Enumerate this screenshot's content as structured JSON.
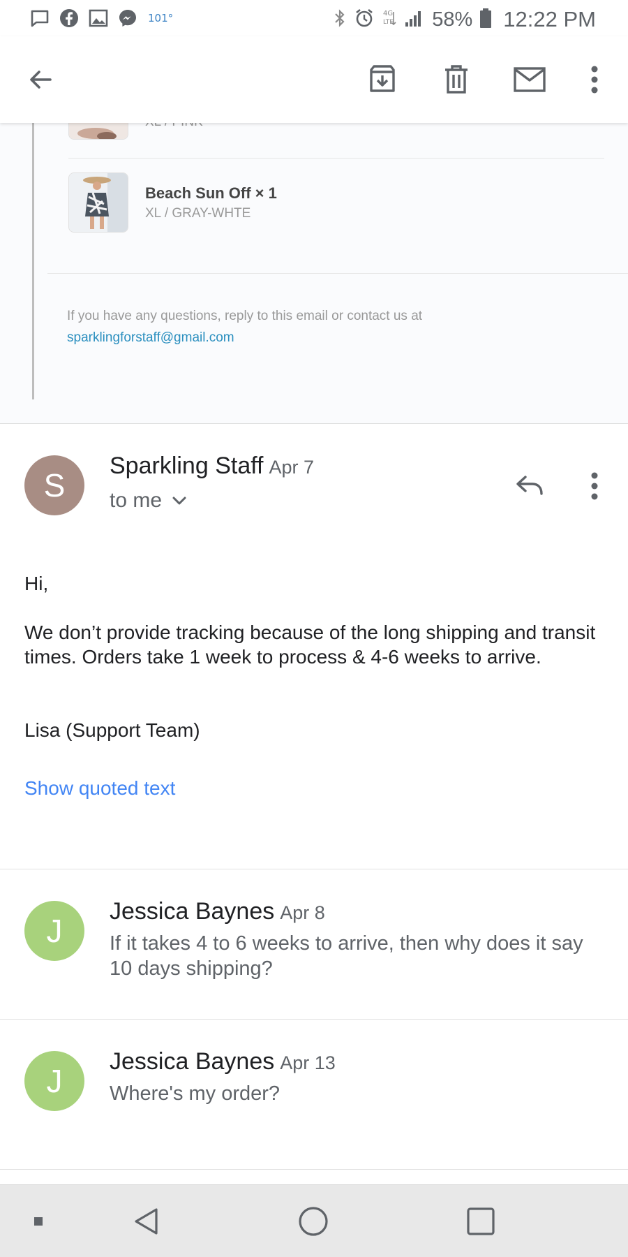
{
  "status_bar": {
    "temperature": "101°",
    "battery_percent": "58%",
    "time": "12:22 PM",
    "left_icons": [
      "message-icon",
      "facebook-icon",
      "gallery-icon",
      "messenger-icon"
    ],
    "right_icons": [
      "bluetooth-icon",
      "alarm-icon",
      "lte-icon",
      "signal-icon",
      "battery-icon"
    ]
  },
  "toolbar": {
    "icons": [
      "back-arrow-icon",
      "archive-icon",
      "delete-icon",
      "mark-unread-icon",
      "more-vert-icon"
    ]
  },
  "quoted_order": {
    "items": [
      {
        "title": "",
        "variant": "XL / PINK"
      },
      {
        "title": "Beach Sun Off × 1",
        "variant": "XL / GRAY-WHTE"
      }
    ],
    "contact_text": "If you have any questions, reply to this email or contact us at",
    "contact_email": "sparklingforstaff@gmail.com"
  },
  "messages": [
    {
      "avatar_letter": "S",
      "avatar_color": "#a88d84",
      "sender": "Sparkling Staff",
      "date": "Apr 7",
      "recipient": "to me",
      "body": {
        "greeting": "Hi,",
        "paragraph": "We don’t provide tracking because of the long shipping and transit times. Orders take 1 week to process & 4-6 weeks to arrive.",
        "signature": "Lisa (Support Team)"
      },
      "show_quoted_label": "Show quoted text"
    },
    {
      "avatar_letter": "J",
      "avatar_color": "#a8d27c",
      "sender": "Jessica Baynes",
      "date": "Apr 8",
      "snippet": "If it takes 4 to 6 weeks to arrive, then why does it say 10 days shipping?"
    },
    {
      "avatar_letter": "J",
      "avatar_color": "#a8d27c",
      "sender": "Jessica Baynes",
      "date": "Apr 13",
      "snippet": "Where's my order?"
    }
  ],
  "nav_bar": {
    "icons": [
      "menu-dot-icon",
      "back-triangle-icon",
      "home-circle-icon",
      "recents-square-icon"
    ]
  }
}
